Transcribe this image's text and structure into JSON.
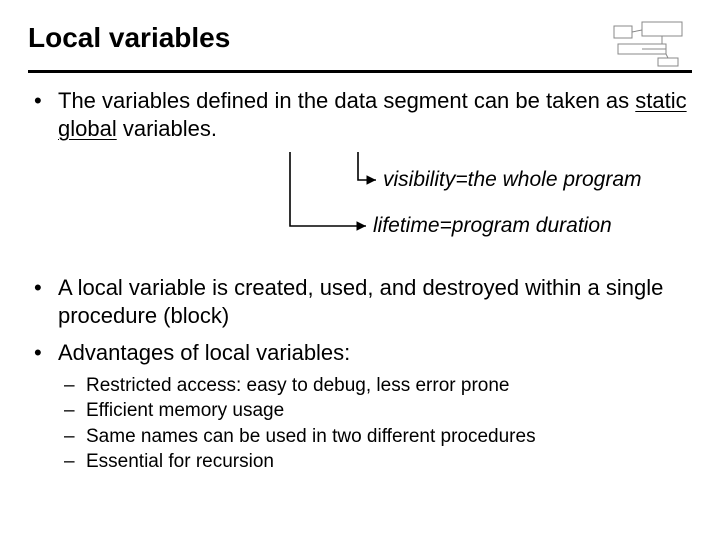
{
  "title": "Local variables",
  "bullet1": {
    "pre": "The variables defined in the data segment can be taken as ",
    "u1": "static",
    "mid": " ",
    "u2": "global",
    "post": " variables."
  },
  "callout1": "visibility=the whole program",
  "callout2": "lifetime=program duration",
  "bullet2": "A local variable is created, used, and destroyed within a single procedure (block)",
  "bullet3": "Advantages of local variables:",
  "sub": {
    "a": "Restricted access: easy to debug, less error prone",
    "b": "Efficient memory usage",
    "c": "Same names can be used in two different procedures",
    "d": "Essential for recursion"
  }
}
